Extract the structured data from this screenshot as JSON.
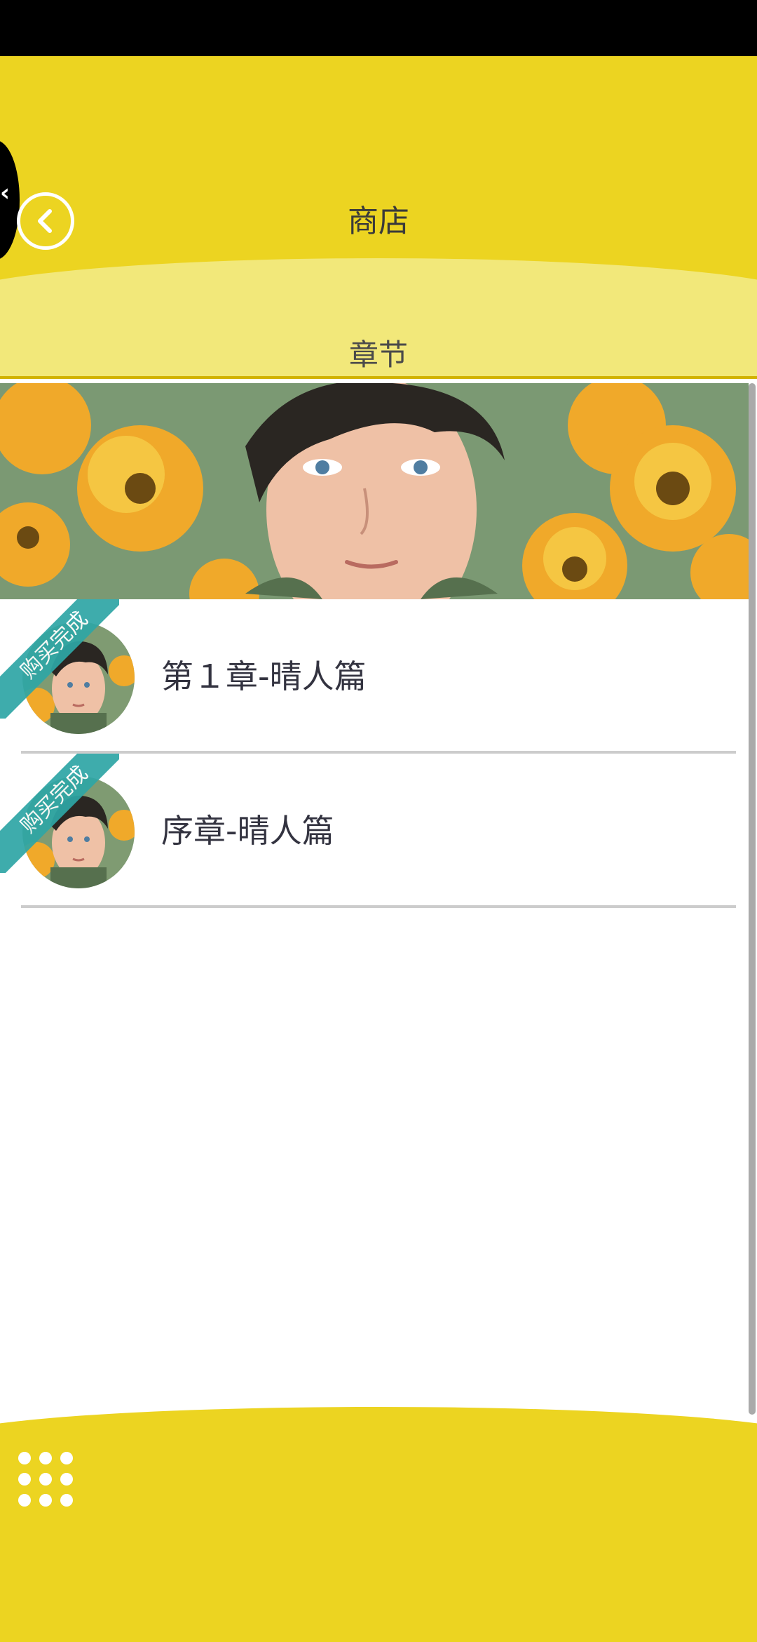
{
  "header": {
    "title": "商店",
    "section_tab": "章节"
  },
  "chapters": [
    {
      "title": "第１章-晴人篇",
      "badge": "购买完成"
    },
    {
      "title": "序章-晴人篇",
      "badge": "购买完成"
    }
  ],
  "icons": {
    "back": "chevron-left-icon",
    "menu": "grid-dots-icon"
  },
  "colors": {
    "header_yellow": "#ecd421",
    "tab_band": "#f2e87a",
    "badge_teal": "#2ea6a6",
    "text_dark": "#333340"
  }
}
